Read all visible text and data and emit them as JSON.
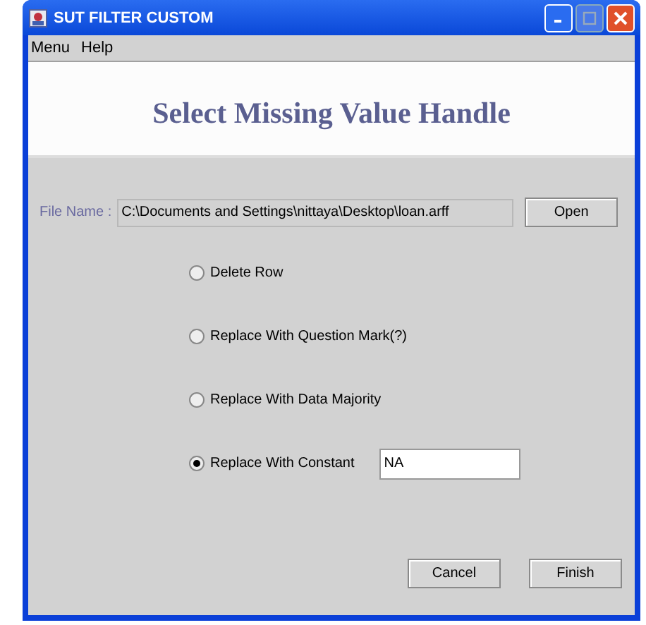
{
  "window": {
    "title": "SUT FILTER CUSTOM"
  },
  "menu": [
    "Menu",
    "Help"
  ],
  "heading": "Select Missing Value Handle",
  "file": {
    "label": "File Name :",
    "value": "C:\\Documents and Settings\\nittaya\\Desktop\\loan.arff",
    "button": "Open"
  },
  "options": [
    {
      "label": "Delete Row",
      "selected": false
    },
    {
      "label": "Replace With Question Mark(?)",
      "selected": false
    },
    {
      "label": "Replace With Data Majority",
      "selected": false
    },
    {
      "label": "Replace With Constant",
      "selected": true,
      "value": "NA"
    }
  ],
  "buttons": [
    "Cancel",
    "Finish"
  ]
}
